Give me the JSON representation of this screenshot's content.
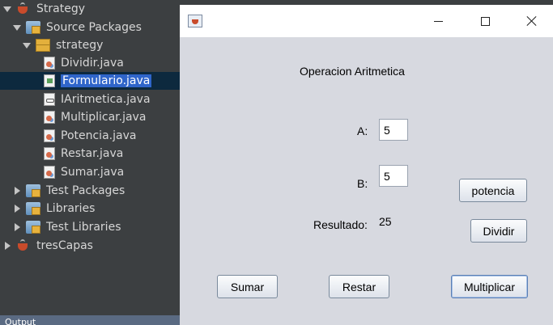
{
  "project_tree": {
    "project": "Strategy",
    "source_packages": "Source Packages",
    "package": "strategy",
    "files": [
      {
        "name": "Dividir.java",
        "type": "java"
      },
      {
        "name": "Formulario.java",
        "type": "form",
        "selected": true
      },
      {
        "name": "IAritmetica.java",
        "type": "interface"
      },
      {
        "name": "Multiplicar.java",
        "type": "java"
      },
      {
        "name": "Potencia.java",
        "type": "java"
      },
      {
        "name": "Restar.java",
        "type": "java"
      },
      {
        "name": "Sumar.java",
        "type": "java"
      }
    ],
    "test_packages": "Test Packages",
    "libraries": "Libraries",
    "test_libraries": "Test Libraries",
    "other_project": "tresCapas",
    "output_tab": "Output"
  },
  "window": {
    "icon": "java-cup-icon",
    "heading": "Operacion Aritmetica",
    "label_a": "A:",
    "value_a": "5",
    "label_b": "B:",
    "value_b": "5",
    "result_label": "Resultado:",
    "result_value": "25",
    "buttons": {
      "potencia": "potencia",
      "dividir": "Dividir",
      "sumar": "Sumar",
      "restar": "Restar",
      "multiplicar": "Multiplicar"
    }
  },
  "colors": {
    "ide_background": "#3c3f41",
    "selection": "#2f65ca",
    "window_background": "#d7d9e0"
  }
}
